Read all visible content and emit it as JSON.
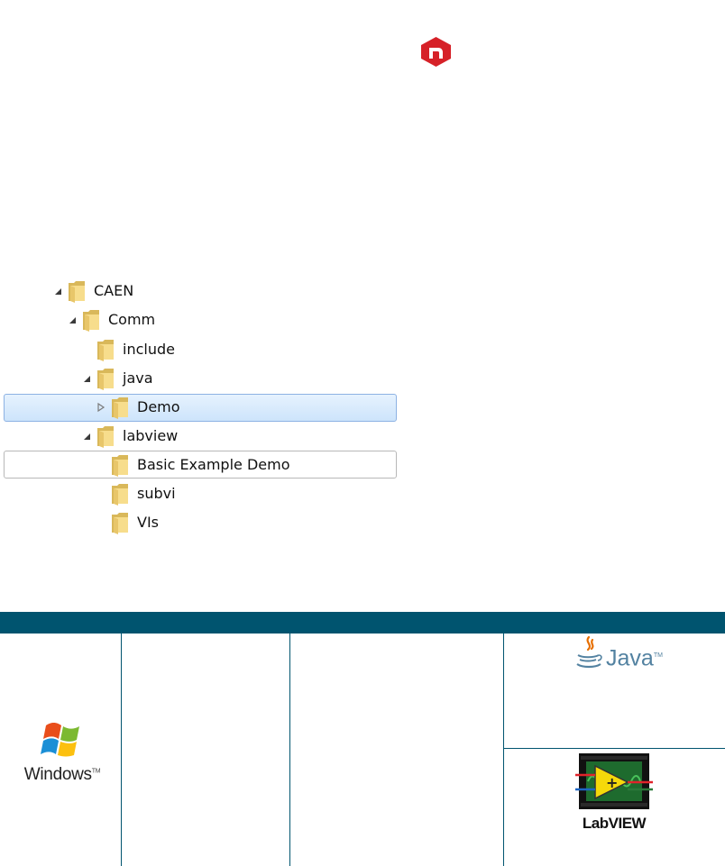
{
  "tree": {
    "items": [
      {
        "label": "CAEN",
        "arrow": "expanded"
      },
      {
        "label": "Comm",
        "arrow": "expanded"
      },
      {
        "label": "include",
        "arrow": "none"
      },
      {
        "label": "java",
        "arrow": "expanded"
      },
      {
        "label": "Demo",
        "arrow": "collapsed",
        "state": "selected"
      },
      {
        "label": "labview",
        "arrow": "expanded"
      },
      {
        "label": "Basic Example Demo",
        "arrow": "none",
        "state": "outlined"
      },
      {
        "label": "subvi",
        "arrow": "none"
      },
      {
        "label": "VIs",
        "arrow": "none"
      }
    ]
  },
  "logos": {
    "windows": {
      "label": "Windows",
      "tm": "TM"
    },
    "java": {
      "label": "Java",
      "tm": "TM"
    },
    "labview": {
      "label": "LabVIEW"
    }
  },
  "colors": {
    "accent": "#00546f",
    "logo_red": "#d62128",
    "selection": "#cde4fb"
  }
}
